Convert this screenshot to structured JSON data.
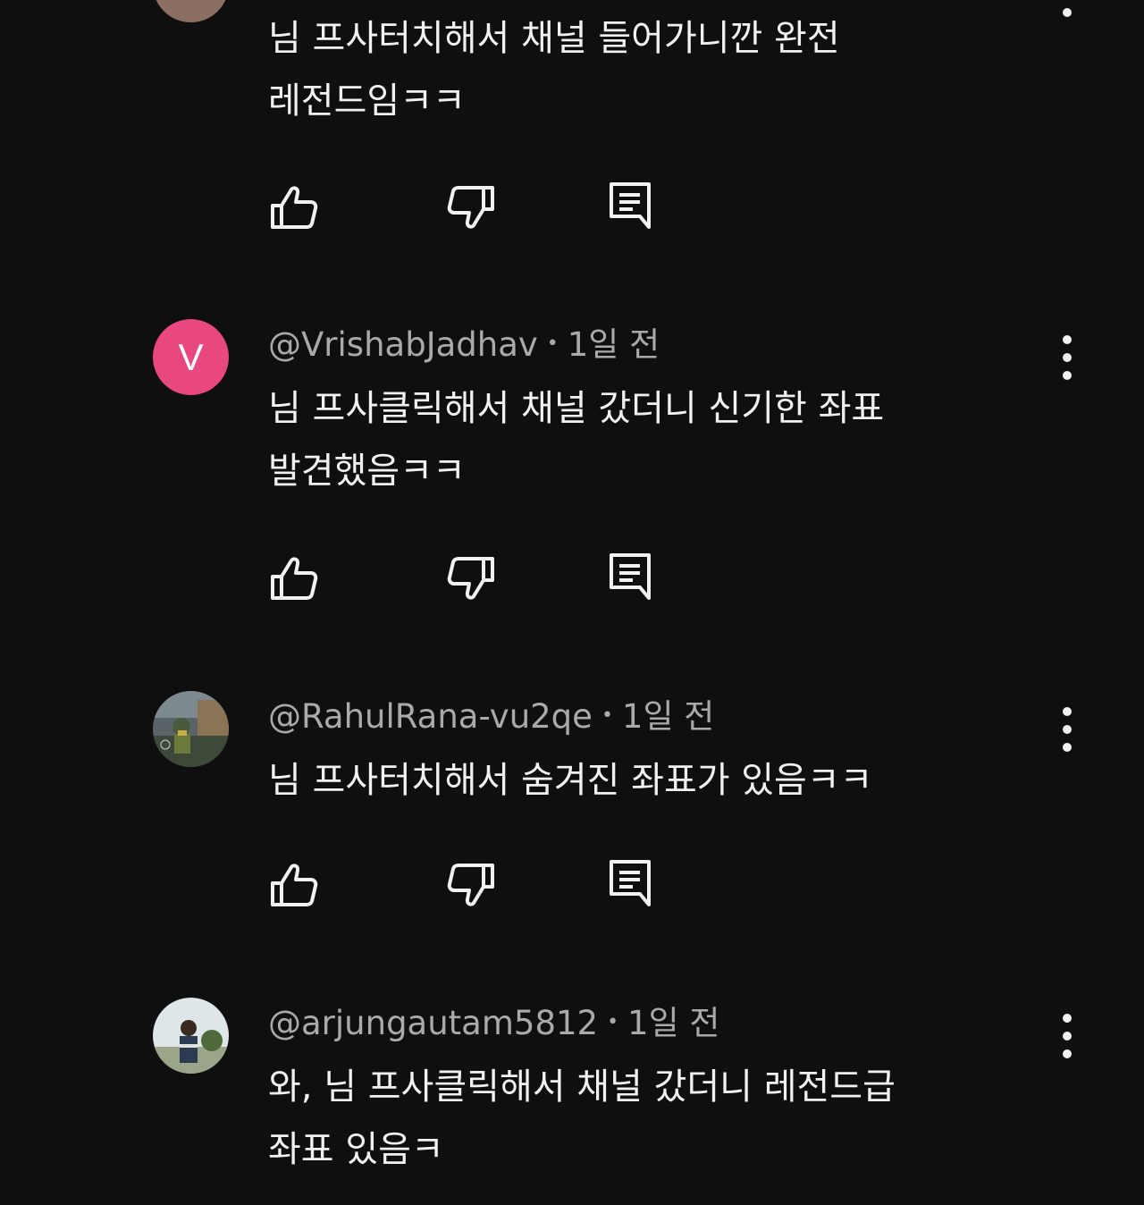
{
  "comments": [
    {
      "author": "",
      "time": "",
      "text_lines": [
        "님 프사터치해서 채널 들어가니깐 완전",
        "레전드임ㅋㅋ"
      ]
    },
    {
      "author": "@VrishabJadhav",
      "separator": "•",
      "time": "1일 전",
      "avatar_letter": "V",
      "text_lines": [
        "님 프사클릭해서 채널 갔더니 신기한 좌표",
        "발견했음ㅋㅋ"
      ]
    },
    {
      "author": "@RahulRana-vu2qe",
      "separator": "•",
      "time": "1일 전",
      "text_lines": [
        "님 프사터치해서 숨겨진 좌표가 있음ㅋㅋ"
      ]
    },
    {
      "author": "@arjungautam5812",
      "separator": "•",
      "time": "1일 전",
      "text_lines": [
        "와, 님 프사클릭해서 채널 갔더니 레전드급",
        "좌표 있음ㅋ"
      ]
    }
  ],
  "icons": {
    "like": "thumbs-up-icon",
    "dislike": "thumbs-down-icon",
    "reply": "reply-icon",
    "menu": "more-vert-icon"
  },
  "colors": {
    "background": "#0f0f0f",
    "text": "#f1f1f1",
    "meta": "#aaaaaa",
    "avatar_v": "#e8477f"
  }
}
